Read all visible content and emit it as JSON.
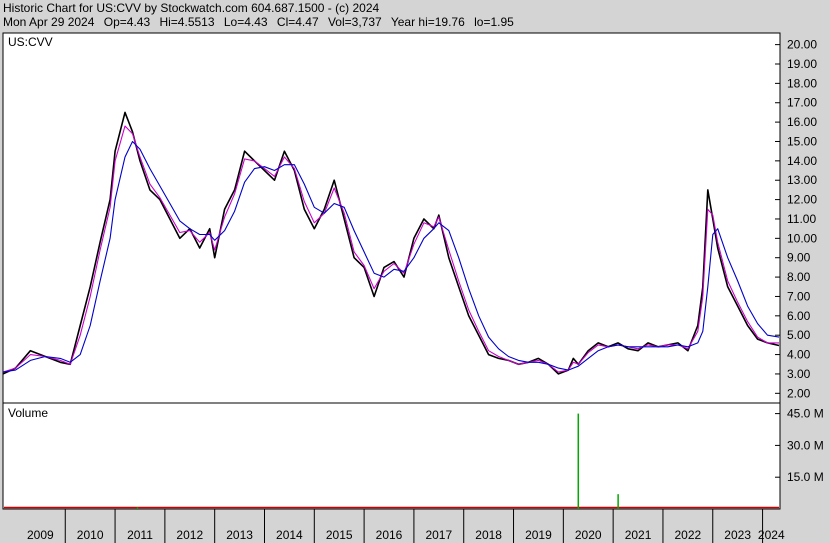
{
  "header": {
    "line1": "Historic Chart for US:CVV by Stockwatch.com 604.687.1500 - (c) 2024",
    "date": "Mon Apr 29 2024",
    "open": "Op=4.43",
    "high": "Hi=4.5513",
    "low": "Lo=4.43",
    "close": "Cl=4.47",
    "volume": "Vol=3,737",
    "year_high": "Year hi=19.76",
    "year_low": "lo=1.95"
  },
  "colors": {
    "background": "#d4d4d4",
    "panel": "#ffffff",
    "price": "#000000",
    "ma_short": "#cc00cc",
    "ma_long": "#0000cc",
    "volume_up": "#00aa00",
    "volume_down": "#cc0000"
  },
  "chart_data": [
    {
      "type": "line",
      "title": "US:CVV",
      "ylim": [
        1.5,
        20.6
      ],
      "yticks": [
        2,
        3,
        4,
        5,
        6,
        7,
        8,
        9,
        10,
        11,
        12,
        13,
        14,
        15,
        16,
        17,
        18,
        19,
        20
      ],
      "ytick_labels": [
        "2.00",
        "3.00",
        "4.00",
        "5.00",
        "6.00",
        "7.00",
        "8.00",
        "9.00",
        "10.00",
        "11.00",
        "12.00",
        "13.00",
        "14.00",
        "15.00",
        "16.00",
        "17.00",
        "18.00",
        "19.00",
        "20.00"
      ],
      "xlim": [
        2008.75,
        2024.35
      ],
      "xtick_labels": [
        "2009",
        "2010",
        "2011",
        "2012",
        "2013",
        "2014",
        "2015",
        "2016",
        "2017",
        "2018",
        "2019",
        "2020",
        "2021",
        "2022",
        "2023",
        "2024"
      ],
      "grid": false,
      "series": [
        {
          "x": [
            2008.75,
            2009.0,
            2009.3,
            2009.6,
            2009.9,
            2010.1,
            2010.3,
            2010.5,
            2010.7,
            2010.9,
            2011.0,
            2011.2,
            2011.35,
            2011.5,
            2011.7,
            2011.9,
            2012.1,
            2012.3,
            2012.5,
            2012.7,
            2012.9,
            2013.0,
            2013.2,
            2013.4,
            2013.6,
            2013.8,
            2014.0,
            2014.2,
            2014.4,
            2014.6,
            2014.8,
            2015.0,
            2015.2,
            2015.4,
            2015.6,
            2015.8,
            2016.0,
            2016.2,
            2016.4,
            2016.6,
            2016.8,
            2017.0,
            2017.2,
            2017.4,
            2017.5,
            2017.7,
            2017.9,
            2018.1,
            2018.3,
            2018.5,
            2018.7,
            2018.9,
            2019.1,
            2019.3,
            2019.5,
            2019.7,
            2019.9,
            2020.1,
            2020.2,
            2020.3,
            2020.5,
            2020.7,
            2020.9,
            2021.1,
            2021.3,
            2021.5,
            2021.7,
            2021.9,
            2022.1,
            2022.3,
            2022.5,
            2022.7,
            2022.8,
            2022.9,
            2023.0,
            2023.1,
            2023.3,
            2023.5,
            2023.7,
            2023.9,
            2024.1,
            2024.33
          ],
          "values": [
            3.0,
            3.3,
            4.2,
            3.9,
            3.6,
            3.5,
            5.5,
            7.5,
            9.8,
            12.0,
            14.5,
            16.5,
            15.5,
            14.0,
            12.5,
            12.0,
            11.0,
            10.0,
            10.5,
            9.5,
            10.5,
            9.0,
            11.5,
            12.5,
            14.5,
            14.0,
            13.5,
            13.0,
            14.5,
            13.5,
            11.5,
            10.5,
            11.5,
            13.0,
            11.0,
            9.0,
            8.5,
            7.0,
            8.5,
            8.8,
            8.0,
            10.0,
            11.0,
            10.5,
            11.2,
            9.0,
            7.5,
            6.0,
            5.0,
            4.0,
            3.8,
            3.7,
            3.5,
            3.6,
            3.8,
            3.5,
            3.0,
            3.2,
            3.8,
            3.5,
            4.2,
            4.6,
            4.4,
            4.6,
            4.3,
            4.2,
            4.6,
            4.4,
            4.5,
            4.6,
            4.2,
            5.5,
            7.5,
            12.5,
            11.0,
            9.5,
            7.5,
            6.5,
            5.5,
            4.8,
            4.6,
            4.47
          ],
          "color": "#000000"
        },
        {
          "x": [
            2008.75,
            2009.0,
            2009.3,
            2009.6,
            2009.9,
            2010.1,
            2010.3,
            2010.5,
            2010.7,
            2010.9,
            2011.0,
            2011.2,
            2011.35,
            2011.5,
            2011.7,
            2011.9,
            2012.1,
            2012.3,
            2012.5,
            2012.7,
            2012.9,
            2013.0,
            2013.2,
            2013.4,
            2013.6,
            2013.8,
            2014.0,
            2014.2,
            2014.4,
            2014.6,
            2014.8,
            2015.0,
            2015.2,
            2015.4,
            2015.6,
            2015.8,
            2016.0,
            2016.2,
            2016.4,
            2016.6,
            2016.8,
            2017.0,
            2017.2,
            2017.4,
            2017.5,
            2017.7,
            2017.9,
            2018.1,
            2018.3,
            2018.5,
            2018.7,
            2018.9,
            2019.1,
            2019.3,
            2019.5,
            2019.7,
            2019.9,
            2020.1,
            2020.2,
            2020.3,
            2020.5,
            2020.7,
            2020.9,
            2021.1,
            2021.3,
            2021.5,
            2021.7,
            2021.9,
            2022.1,
            2022.3,
            2022.5,
            2022.7,
            2022.8,
            2022.9,
            2023.0,
            2023.1,
            2023.3,
            2023.5,
            2023.7,
            2023.9,
            2024.1,
            2024.33
          ],
          "values": [
            3.1,
            3.3,
            4.0,
            3.9,
            3.7,
            3.5,
            5.0,
            7.0,
            9.4,
            11.6,
            14.0,
            15.8,
            15.4,
            14.2,
            12.8,
            12.1,
            11.2,
            10.3,
            10.4,
            9.8,
            10.3,
            9.4,
            11.1,
            12.3,
            14.1,
            14.0,
            13.6,
            13.2,
            14.2,
            13.6,
            11.9,
            10.8,
            11.3,
            12.6,
            11.3,
            9.3,
            8.6,
            7.4,
            8.3,
            8.7,
            8.2,
            9.7,
            10.8,
            10.6,
            11.1,
            9.4,
            7.8,
            6.3,
            5.2,
            4.2,
            3.9,
            3.7,
            3.5,
            3.6,
            3.7,
            3.5,
            3.1,
            3.2,
            3.6,
            3.5,
            4.1,
            4.5,
            4.4,
            4.5,
            4.4,
            4.3,
            4.5,
            4.4,
            4.5,
            4.5,
            4.3,
            5.2,
            7.0,
            11.5,
            11.2,
            9.8,
            7.8,
            6.7,
            5.7,
            4.9,
            4.6,
            4.6
          ],
          "color": "#cc00cc"
        },
        {
          "x": [
            2008.75,
            2009.0,
            2009.3,
            2009.6,
            2009.9,
            2010.1,
            2010.3,
            2010.5,
            2010.7,
            2010.9,
            2011.0,
            2011.2,
            2011.35,
            2011.5,
            2011.7,
            2011.9,
            2012.1,
            2012.3,
            2012.5,
            2012.7,
            2012.9,
            2013.0,
            2013.2,
            2013.4,
            2013.6,
            2013.8,
            2014.0,
            2014.2,
            2014.4,
            2014.6,
            2014.8,
            2015.0,
            2015.2,
            2015.4,
            2015.6,
            2015.8,
            2016.0,
            2016.2,
            2016.4,
            2016.6,
            2016.8,
            2017.0,
            2017.2,
            2017.4,
            2017.5,
            2017.7,
            2017.9,
            2018.1,
            2018.3,
            2018.5,
            2018.7,
            2018.9,
            2019.1,
            2019.3,
            2019.5,
            2019.7,
            2019.9,
            2020.1,
            2020.2,
            2020.3,
            2020.5,
            2020.7,
            2020.9,
            2021.1,
            2021.3,
            2021.5,
            2021.7,
            2021.9,
            2022.1,
            2022.3,
            2022.5,
            2022.7,
            2022.8,
            2022.9,
            2023.0,
            2023.1,
            2023.3,
            2023.5,
            2023.7,
            2023.9,
            2024.1,
            2024.33
          ],
          "values": [
            3.1,
            3.2,
            3.7,
            3.9,
            3.8,
            3.6,
            4.0,
            5.5,
            7.8,
            10.0,
            12.0,
            14.2,
            15.0,
            14.6,
            13.6,
            12.7,
            11.8,
            10.9,
            10.5,
            10.2,
            10.2,
            9.9,
            10.4,
            11.4,
            12.9,
            13.6,
            13.7,
            13.5,
            13.8,
            13.8,
            12.8,
            11.6,
            11.3,
            11.8,
            11.6,
            10.4,
            9.3,
            8.2,
            8.0,
            8.4,
            8.3,
            9.0,
            10.0,
            10.5,
            10.8,
            10.4,
            9.0,
            7.4,
            6.0,
            4.9,
            4.3,
            3.9,
            3.7,
            3.6,
            3.6,
            3.5,
            3.3,
            3.2,
            3.3,
            3.4,
            3.8,
            4.2,
            4.4,
            4.5,
            4.4,
            4.4,
            4.4,
            4.4,
            4.4,
            4.5,
            4.4,
            4.6,
            5.2,
            7.5,
            10.2,
            10.5,
            9.0,
            7.8,
            6.5,
            5.6,
            5.0,
            4.9
          ],
          "color": "#0000cc"
        }
      ]
    },
    {
      "type": "bar",
      "title": "Volume",
      "ylim": [
        0,
        50
      ],
      "yticks": [
        15,
        30,
        45
      ],
      "ytick_labels": [
        "15.0 M",
        "30.0 M",
        "45.0 M"
      ],
      "xlim": [
        2008.75,
        2024.35
      ],
      "x": [
        2011.45,
        2020.3,
        2021.1
      ],
      "values": [
        0.8,
        45.0,
        7.0
      ]
    }
  ]
}
